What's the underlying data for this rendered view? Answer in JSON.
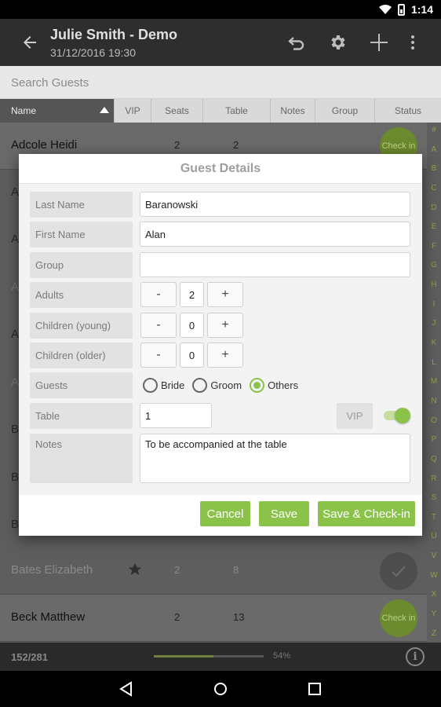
{
  "status_bar": {
    "time": "1:14"
  },
  "app_bar": {
    "title": "Julie Smith - Demo",
    "subtitle": "31/12/2016 19:30",
    "icons": [
      "back-arrow-icon",
      "undo-icon",
      "gear-icon",
      "plus-icon",
      "overflow-menu-icon"
    ]
  },
  "search": {
    "placeholder": "Search Guests"
  },
  "columns": [
    "Name",
    "VIP",
    "Seats",
    "Table",
    "Notes",
    "Group",
    "Status"
  ],
  "rows": [
    {
      "name": "Adcole Heidi",
      "seats": "2",
      "table": "2",
      "status": "Check in"
    },
    {
      "name": "Bates Elizabeth",
      "seats": "2",
      "table": "8",
      "vip": true,
      "status": "checked"
    },
    {
      "name": "Beck Matthew",
      "seats": "2",
      "table": "13",
      "status": "Check in"
    }
  ],
  "row_initials": [
    "A",
    "A",
    "A",
    "A",
    "A",
    "B",
    "B",
    "B"
  ],
  "alphabet": [
    "#",
    "A",
    "B",
    "C",
    "D",
    "E",
    "F",
    "G",
    "H",
    "I",
    "J",
    "K",
    "L",
    "M",
    "N",
    "O",
    "P",
    "Q",
    "R",
    "S",
    "T",
    "U",
    "V",
    "W",
    "X",
    "Y",
    "Z"
  ],
  "footer": {
    "count": "152/281",
    "percent": "54%",
    "progress": 0.54,
    "info_icon": "info-icon"
  },
  "dialog": {
    "title": "Guest Details",
    "labels": {
      "last_name": "Last Name",
      "first_name": "First Name",
      "group": "Group",
      "adults": "Adults",
      "children_young": "Children (young)",
      "children_older": "Children (older)",
      "guests": "Guests",
      "table": "Table",
      "notes": "Notes",
      "vip": "VIP"
    },
    "values": {
      "last_name": "Baranowski",
      "first_name": "Alan",
      "group": "",
      "adults": "2",
      "children_young": "0",
      "children_older": "0",
      "table": "1",
      "notes": "To be accompanied at the table",
      "vip_on": true
    },
    "stepper": {
      "minus": "-",
      "plus": "+"
    },
    "guest_options": [
      {
        "label": "Bride",
        "selected": false
      },
      {
        "label": "Groom",
        "selected": false
      },
      {
        "label": "Others",
        "selected": true
      }
    ],
    "buttons": {
      "cancel": "Cancel",
      "save": "Save",
      "save_checkin": "Save & Check-in"
    },
    "accent_color": "#8bc34a"
  },
  "nav_bar": {
    "icons": [
      "back-triangle-icon",
      "home-circle-icon",
      "recents-square-icon"
    ]
  }
}
